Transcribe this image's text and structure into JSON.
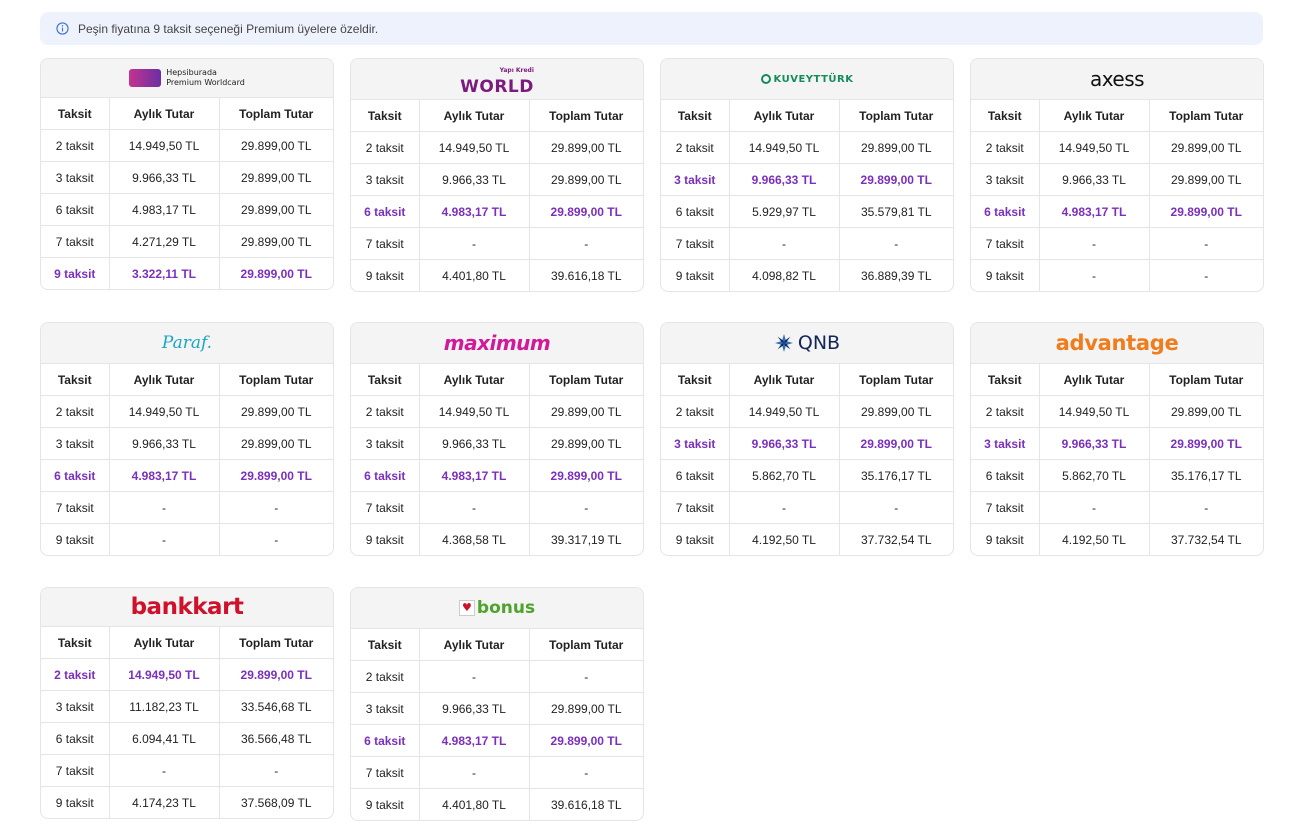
{
  "notice": {
    "text": "Peşin fiyatına 9 taksit seçeneği Premium üyelere özeldir.",
    "icon": "info-icon"
  },
  "columns": [
    "Taksit",
    "Aylık Tutar",
    "Toplam Tutar"
  ],
  "accent_color": "#7b2fbe",
  "cards": [
    {
      "bank": "hepsiburada",
      "logo": [
        "Hepsiburada",
        "Premium Worldcard"
      ],
      "rows": [
        [
          "2 taksit",
          "14.949,50 TL",
          "29.899,00 TL"
        ],
        [
          "3 taksit",
          "9.966,33 TL",
          "29.899,00 TL"
        ],
        [
          "6 taksit",
          "4.983,17 TL",
          "29.899,00 TL"
        ],
        [
          "7 taksit",
          "4.271,29 TL",
          "29.899,00 TL"
        ],
        [
          "9 taksit",
          "3.322,11 TL",
          "29.899,00 TL"
        ]
      ],
      "highlight": 4
    },
    {
      "bank": "world",
      "logo": [
        "Yapı Kredi",
        "WORLD"
      ],
      "rows": [
        [
          "2 taksit",
          "14.949,50 TL",
          "29.899,00 TL"
        ],
        [
          "3 taksit",
          "9.966,33 TL",
          "29.899,00 TL"
        ],
        [
          "6 taksit",
          "4.983,17 TL",
          "29.899,00 TL"
        ],
        [
          "7 taksit",
          "-",
          "-"
        ],
        [
          "9 taksit",
          "4.401,80 TL",
          "39.616,18 TL"
        ]
      ],
      "highlight": 2
    },
    {
      "bank": "kuveytturk",
      "logo": [
        "KUVEYTTÜRK"
      ],
      "rows": [
        [
          "2 taksit",
          "14.949,50 TL",
          "29.899,00 TL"
        ],
        [
          "3 taksit",
          "9.966,33 TL",
          "29.899,00 TL"
        ],
        [
          "6 taksit",
          "5.929,97 TL",
          "35.579,81 TL"
        ],
        [
          "7 taksit",
          "-",
          "-"
        ],
        [
          "9 taksit",
          "4.098,82 TL",
          "36.889,39 TL"
        ]
      ],
      "highlight": 1
    },
    {
      "bank": "axess",
      "logo": [
        "axess"
      ],
      "rows": [
        [
          "2 taksit",
          "14.949,50 TL",
          "29.899,00 TL"
        ],
        [
          "3 taksit",
          "9.966,33 TL",
          "29.899,00 TL"
        ],
        [
          "6 taksit",
          "4.983,17 TL",
          "29.899,00 TL"
        ],
        [
          "7 taksit",
          "-",
          "-"
        ],
        [
          "9 taksit",
          "-",
          "-"
        ]
      ],
      "highlight": 2
    },
    {
      "bank": "paraf",
      "logo": [
        "Paraf."
      ],
      "rows": [
        [
          "2 taksit",
          "14.949,50 TL",
          "29.899,00 TL"
        ],
        [
          "3 taksit",
          "9.966,33 TL",
          "29.899,00 TL"
        ],
        [
          "6 taksit",
          "4.983,17 TL",
          "29.899,00 TL"
        ],
        [
          "7 taksit",
          "-",
          "-"
        ],
        [
          "9 taksit",
          "-",
          "-"
        ]
      ],
      "highlight": 2
    },
    {
      "bank": "maximum",
      "logo": [
        "maximum"
      ],
      "rows": [
        [
          "2 taksit",
          "14.949,50 TL",
          "29.899,00 TL"
        ],
        [
          "3 taksit",
          "9.966,33 TL",
          "29.899,00 TL"
        ],
        [
          "6 taksit",
          "4.983,17 TL",
          "29.899,00 TL"
        ],
        [
          "7 taksit",
          "-",
          "-"
        ],
        [
          "9 taksit",
          "4.368,58 TL",
          "39.317,19 TL"
        ]
      ],
      "highlight": 2
    },
    {
      "bank": "qnb",
      "logo": [
        "QNB"
      ],
      "rows": [
        [
          "2 taksit",
          "14.949,50 TL",
          "29.899,00 TL"
        ],
        [
          "3 taksit",
          "9.966,33 TL",
          "29.899,00 TL"
        ],
        [
          "6 taksit",
          "5.862,70 TL",
          "35.176,17 TL"
        ],
        [
          "7 taksit",
          "-",
          "-"
        ],
        [
          "9 taksit",
          "4.192,50 TL",
          "37.732,54 TL"
        ]
      ],
      "highlight": 1
    },
    {
      "bank": "advantage",
      "logo": [
        "advantage"
      ],
      "rows": [
        [
          "2 taksit",
          "14.949,50 TL",
          "29.899,00 TL"
        ],
        [
          "3 taksit",
          "9.966,33 TL",
          "29.899,00 TL"
        ],
        [
          "6 taksit",
          "5.862,70 TL",
          "35.176,17 TL"
        ],
        [
          "7 taksit",
          "-",
          "-"
        ],
        [
          "9 taksit",
          "4.192,50 TL",
          "37.732,54 TL"
        ]
      ],
      "highlight": 1
    },
    {
      "bank": "bankkart",
      "logo": [
        "bankkart"
      ],
      "rows": [
        [
          "2 taksit",
          "14.949,50 TL",
          "29.899,00 TL"
        ],
        [
          "3 taksit",
          "11.182,23 TL",
          "33.546,68 TL"
        ],
        [
          "6 taksit",
          "6.094,41 TL",
          "36.566,48 TL"
        ],
        [
          "7 taksit",
          "-",
          "-"
        ],
        [
          "9 taksit",
          "4.174,23 TL",
          "37.568,09 TL"
        ]
      ],
      "highlight": 0
    },
    {
      "bank": "bonus",
      "logo": [
        "bonus"
      ],
      "rows": [
        [
          "2 taksit",
          "-",
          "-"
        ],
        [
          "3 taksit",
          "9.966,33 TL",
          "29.899,00 TL"
        ],
        [
          "6 taksit",
          "4.983,17 TL",
          "29.899,00 TL"
        ],
        [
          "7 taksit",
          "-",
          "-"
        ],
        [
          "9 taksit",
          "4.401,80 TL",
          "39.616,18 TL"
        ]
      ],
      "highlight": 2
    }
  ]
}
